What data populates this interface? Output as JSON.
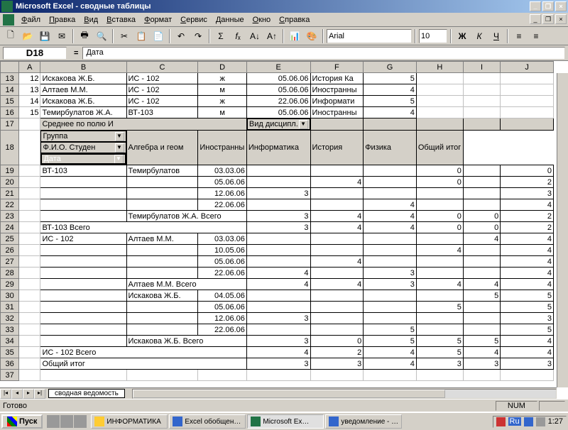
{
  "title": "Microsoft Excel - сводные таблицы",
  "menu": [
    "Файл",
    "Правка",
    "Вид",
    "Вставка",
    "Формат",
    "Сервис",
    "Данные",
    "Окно",
    "Справка"
  ],
  "font": {
    "name": "Arial",
    "size": "10"
  },
  "namebox": "D18",
  "formula": "Дата",
  "cols": [
    "A",
    "B",
    "C",
    "D",
    "E",
    "F",
    "G",
    "H",
    "I",
    "J"
  ],
  "toprows": [
    {
      "r": "13",
      "a": "12",
      "b": "Искакова Ж.Б.",
      "c": "ИС - 102",
      "d": "ж",
      "e": "05.06.06",
      "f": "История Ка",
      "g": "5"
    },
    {
      "r": "14",
      "a": "13",
      "b": "Алтаев М.М.",
      "c": "ИС - 102",
      "d": "м",
      "e": "05.06.06",
      "f": "Иностранны",
      "g": "4"
    },
    {
      "r": "15",
      "a": "14",
      "b": "Искакова Ж.Б.",
      "c": "ИС - 102",
      "d": "ж",
      "e": "22.06.06",
      "f": "Информати",
      "g": "5"
    },
    {
      "r": "16",
      "a": "15",
      "b": "Темирбулатов Ж.А.",
      "c": "ВТ-103",
      "d": "м",
      "e": "05.06.06",
      "f": "Иностранны",
      "g": "4"
    }
  ],
  "r17": {
    "b": "Среднее по полю И",
    "e": "Вид дисципл."
  },
  "r18": {
    "b": "Группа",
    "c": "Ф.И.О. Студен",
    "d": "Дата",
    "e": "Алгебра и геом",
    "f": "Иностранны",
    "g": "Информатика",
    "h": "История",
    "i": "Физика",
    "j": "Общий итог"
  },
  "pivot": [
    {
      "r": "19",
      "b": "ВТ-103",
      "c": "Темирбулатов",
      "d": "03.03.06",
      "h": "0",
      "j": "0"
    },
    {
      "r": "20",
      "b": "",
      "c": "",
      "d": "05.06.06",
      "f": "4",
      "h": "0",
      "j": "2"
    },
    {
      "r": "21",
      "b": "",
      "c": "",
      "d": "12.06.06",
      "e": "3",
      "j": "3"
    },
    {
      "r": "22",
      "b": "",
      "c": "",
      "d": "22.06.06",
      "g": "4",
      "j": "4"
    },
    {
      "r": "23",
      "b": "",
      "c": "Темирбулатов Ж.А. Всего",
      "e": "3",
      "f": "4",
      "g": "4",
      "h": "0",
      "i": "0",
      "j": "2"
    },
    {
      "r": "24",
      "b": "ВТ-103 Всего",
      "e": "3",
      "f": "4",
      "g": "4",
      "h": "0",
      "i": "0",
      "j": "2"
    },
    {
      "r": "25",
      "b": "ИС - 102",
      "c": "Алтаев М.М.",
      "d": "03.03.06",
      "i": "4",
      "j": "4"
    },
    {
      "r": "26",
      "b": "",
      "c": "",
      "d": "10.05.06",
      "h": "4",
      "j": "4"
    },
    {
      "r": "27",
      "b": "",
      "c": "",
      "d": "05.06.06",
      "f": "4",
      "j": "4"
    },
    {
      "r": "28",
      "b": "",
      "c": "",
      "d": "22.06.06",
      "e": "4",
      "g": "3",
      "j": "4"
    },
    {
      "r": "29",
      "b": "",
      "c": "Алтаев М.М. Всего",
      "e": "4",
      "f": "4",
      "g": "3",
      "h": "4",
      "i": "4",
      "j": "4"
    },
    {
      "r": "30",
      "b": "",
      "c": "Искакова Ж.Б.",
      "d": "04.05.06",
      "i": "5",
      "j": "5"
    },
    {
      "r": "31",
      "b": "",
      "c": "",
      "d": "05.06.06",
      "h": "5",
      "j": "5"
    },
    {
      "r": "32",
      "b": "",
      "c": "",
      "d": "12.06.06",
      "e": "3",
      "j": "3"
    },
    {
      "r": "33",
      "b": "",
      "c": "",
      "d": "22.06.06",
      "g": "5",
      "j": "5"
    },
    {
      "r": "34",
      "b": "",
      "c": "Искакова Ж.Б. Всего",
      "e": "3",
      "f": "0",
      "g": "5",
      "h": "5",
      "i": "5",
      "j": "4"
    },
    {
      "r": "35",
      "b": "ИС - 102 Всего",
      "e": "4",
      "f": "2",
      "g": "4",
      "h": "5",
      "i": "4",
      "j": "4"
    },
    {
      "r": "36",
      "b": "Общий итог",
      "e": "3",
      "f": "3",
      "g": "4",
      "h": "3",
      "i": "3",
      "j": "3"
    }
  ],
  "sheettab": "сводная ведомость",
  "status": "Готово",
  "numlock": "NUM",
  "start": "Пуск",
  "tasks": [
    "ИНФОРМАТИКА",
    "Excel обобщен…",
    "Microsoft Ex…",
    "уведомление - …"
  ],
  "tray": {
    "lang": "Ru",
    "time": "1:27"
  }
}
